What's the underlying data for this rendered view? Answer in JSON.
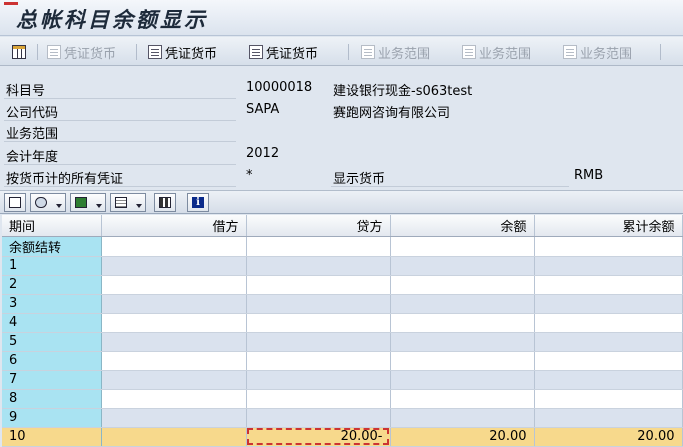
{
  "window": {
    "title": "总帐科目余额显示"
  },
  "toolbar": {
    "buttons": [
      {
        "label": "",
        "icon": "grid-icon",
        "enabled": true
      },
      {
        "label": "凭证货币",
        "icon": "document-icon",
        "enabled": false
      },
      {
        "label": "凭证货币",
        "icon": "document-icon",
        "enabled": true
      },
      {
        "label": "凭证货币",
        "icon": "document-icon",
        "enabled": true
      },
      {
        "label": "业务范围",
        "icon": "document-icon",
        "enabled": false
      },
      {
        "label": "业务范围",
        "icon": "document-icon",
        "enabled": false
      },
      {
        "label": "业务范围",
        "icon": "document-icon",
        "enabled": false
      }
    ]
  },
  "header_info": {
    "account": {
      "label": "科目号",
      "value": "10000018",
      "description": "建设银行现金-s063test"
    },
    "company_code": {
      "label": "公司代码",
      "value": "SAPA",
      "description": "赛跑网咨询有限公司"
    },
    "business_area": {
      "label": "业务范围",
      "value": ""
    },
    "fiscal_year": {
      "label": "会计年度",
      "value": "2012"
    },
    "all_docs": {
      "label": "按货币计的所有凭证",
      "value": "*",
      "display_currency_label": "显示货币",
      "display_currency": "RMB"
    }
  },
  "alv_toolbar": {
    "buttons": [
      {
        "icon": "print-icon"
      },
      {
        "icon": "view-icon",
        "dropdown": true
      },
      {
        "icon": "export-icon",
        "dropdown": true
      },
      {
        "icon": "layout-icon",
        "dropdown": true
      },
      {
        "icon": "chart-icon"
      },
      {
        "icon": "info-icon",
        "text": "i"
      }
    ]
  },
  "table": {
    "columns": [
      "期间",
      "借方",
      "贷方",
      "余额",
      "累计余额"
    ],
    "rows": [
      [
        "余额结转",
        "",
        "",
        "",
        ""
      ],
      [
        "1",
        "",
        "",
        "",
        ""
      ],
      [
        "2",
        "",
        "",
        "",
        ""
      ],
      [
        "3",
        "",
        "",
        "",
        ""
      ],
      [
        "4",
        "",
        "",
        "",
        ""
      ],
      [
        "5",
        "",
        "",
        "",
        ""
      ],
      [
        "6",
        "",
        "",
        "",
        ""
      ],
      [
        "7",
        "",
        "",
        "",
        ""
      ],
      [
        "8",
        "",
        "",
        "",
        ""
      ],
      [
        "9",
        "",
        "",
        "",
        ""
      ]
    ],
    "total_row": [
      "10",
      "",
      "20.00-",
      "20.00",
      "20.00"
    ]
  },
  "colors": {
    "key_column": "#a9e3f2",
    "total_row": "#f7d98c",
    "stripe": "#dae2ee"
  }
}
